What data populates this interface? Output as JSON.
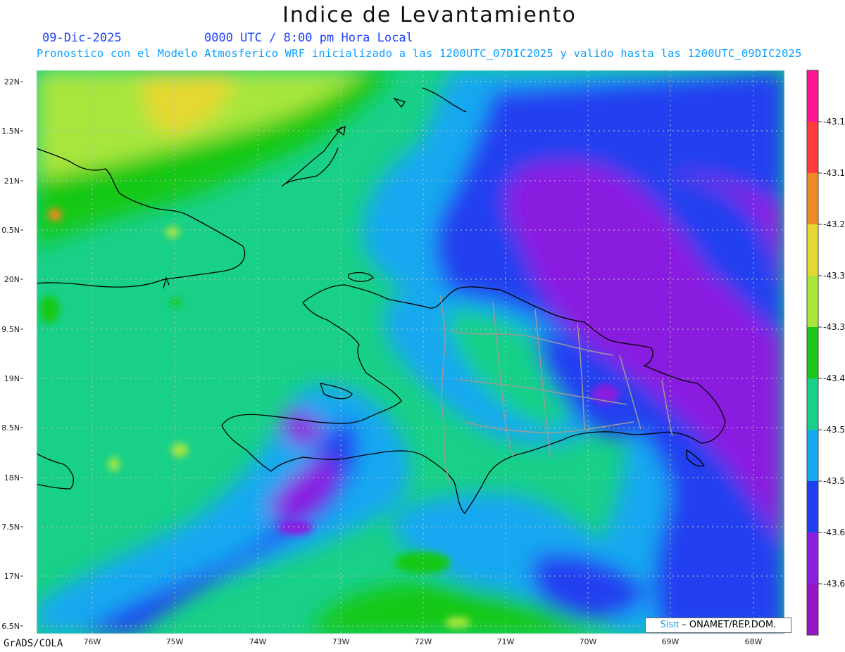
{
  "title": "Indice de Levantamiento",
  "date_label": "09-Dic-2025",
  "time_label": "0000 UTC / 8:00 pm Hora Local",
  "description": "Pronostico con el Modelo Atmosferico WRF inicializado a las 1200UTC_07DIC2025 y valido hasta las  1200UTC_09DIC2025",
  "footer": "GrADS/COLA",
  "credit": {
    "logo": "Sisπ",
    "text": " – ONAMET/REP.DOM."
  },
  "colorbar": {
    "colors": [
      "#ff1493",
      "#ff3b3b",
      "#f08a24",
      "#e6d833",
      "#a8e63c",
      "#19c819",
      "#18d088",
      "#16a8f0",
      "#2040f0",
      "#8a1fe0",
      "#9812c8"
    ],
    "labels": [
      "-43.1",
      "-43.1",
      "-43.2",
      "-43.3",
      "-43.3",
      "-43.4",
      "-43.5",
      "-43.5",
      "-43.6",
      "-43.6"
    ]
  },
  "map": {
    "lat_labels": [
      "22N",
      "1.5N",
      "21N",
      "0.5N",
      "20N",
      "9.5N",
      "19N",
      "8.5N",
      "18N",
      "7.5N",
      "17N",
      "6.5N"
    ],
    "lon_labels": [
      "76W",
      "75W",
      "74W",
      "73W",
      "72W",
      "71W",
      "70W",
      "69W",
      "68W"
    ]
  }
}
